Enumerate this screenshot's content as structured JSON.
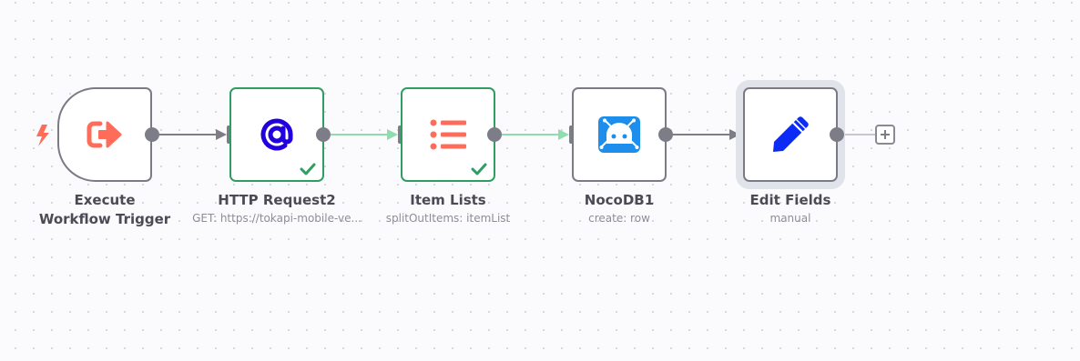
{
  "workflow": {
    "nodes": [
      {
        "id": "execute-workflow-trigger",
        "title": "Execute Workflow Trigger",
        "subtitle": "",
        "icon": "sign-out-icon",
        "icon_color": "#ff6d5a",
        "status": "none"
      },
      {
        "id": "http-request2",
        "title": "HTTP Request2",
        "subtitle": "GET: https://tokapi-mobile-ve...",
        "icon": "at-sign-icon",
        "icon_color": "#2200dd",
        "status": "success"
      },
      {
        "id": "item-lists",
        "title": "Item Lists",
        "subtitle": "splitOutItems: itemList",
        "icon": "list-icon",
        "icon_color": "#ff6d5a",
        "status": "success"
      },
      {
        "id": "nocodb1",
        "title": "NocoDB1",
        "subtitle": "create: row",
        "icon": "nocodb-icon",
        "icon_color": "#1d8eeb",
        "status": "none"
      },
      {
        "id": "edit-fields",
        "title": "Edit Fields",
        "subtitle": "manual",
        "icon": "pencil-icon",
        "icon_color": "#0c2bf5",
        "status": "selected"
      }
    ],
    "connections": [
      {
        "from": "execute-workflow-trigger",
        "to": "http-request2",
        "state": "default"
      },
      {
        "from": "http-request2",
        "to": "item-lists",
        "state": "success"
      },
      {
        "from": "item-lists",
        "to": "nocodb1",
        "state": "success"
      },
      {
        "from": "nocodb1",
        "to": "edit-fields",
        "state": "default"
      }
    ],
    "trigger_icon": "bolt-icon",
    "add_button_icon": "plus-icon"
  },
  "colors": {
    "default_edge": "#7d7d87",
    "success_edge": "#8fdcae",
    "success_border": "#2f9e62",
    "trigger_bolt": "#ff6d5a"
  }
}
